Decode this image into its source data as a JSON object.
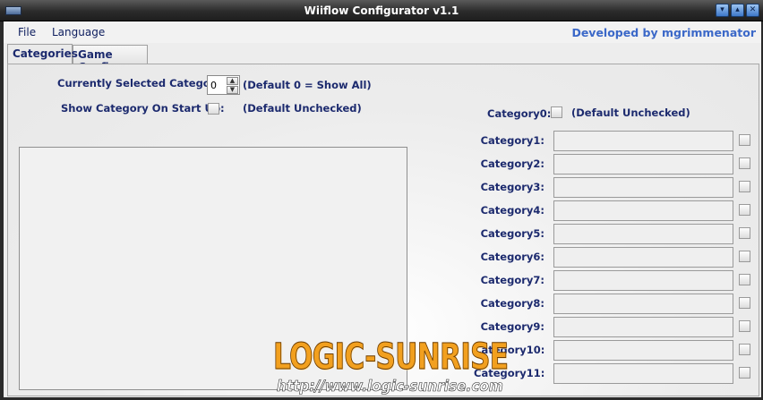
{
  "window": {
    "title": "Wiiflow Configurator v1.1",
    "controls": [
      "▾",
      "▴",
      "✕"
    ]
  },
  "menu": {
    "items": [
      "File",
      "Language"
    ],
    "developed_by": "Developed by mgrimmenator"
  },
  "tabs": [
    {
      "label": "Categories",
      "active": true
    },
    {
      "label": "Game Config",
      "active": false
    }
  ],
  "categories_tab": {
    "selected_label": "Currently Selected Category:",
    "selected_value": "0",
    "selected_hint": "(Default 0 = Show All)",
    "show_on_start_label": "Show Category On Start Up:",
    "show_on_start_hint": "(Default Unchecked)",
    "category0_label": "Category0:",
    "category0_hint": "(Default Unchecked)",
    "categories": [
      {
        "label": "Category1:",
        "value": ""
      },
      {
        "label": "Category2:",
        "value": ""
      },
      {
        "label": "Category3:",
        "value": ""
      },
      {
        "label": "Category4:",
        "value": ""
      },
      {
        "label": "Category5:",
        "value": ""
      },
      {
        "label": "Category6:",
        "value": ""
      },
      {
        "label": "Category7:",
        "value": ""
      },
      {
        "label": "Category8:",
        "value": ""
      },
      {
        "label": "Category9:",
        "value": ""
      },
      {
        "label": "Category10:",
        "value": ""
      },
      {
        "label": "Category11:",
        "value": ""
      }
    ]
  },
  "watermark": {
    "brand": "LOGIC-SUNRISE",
    "url": "http://www.logic-sunrise.com"
  },
  "colors": {
    "label": "#1c2a6e",
    "accent_link": "#3b68c8",
    "watermark": "#f2a01f"
  }
}
